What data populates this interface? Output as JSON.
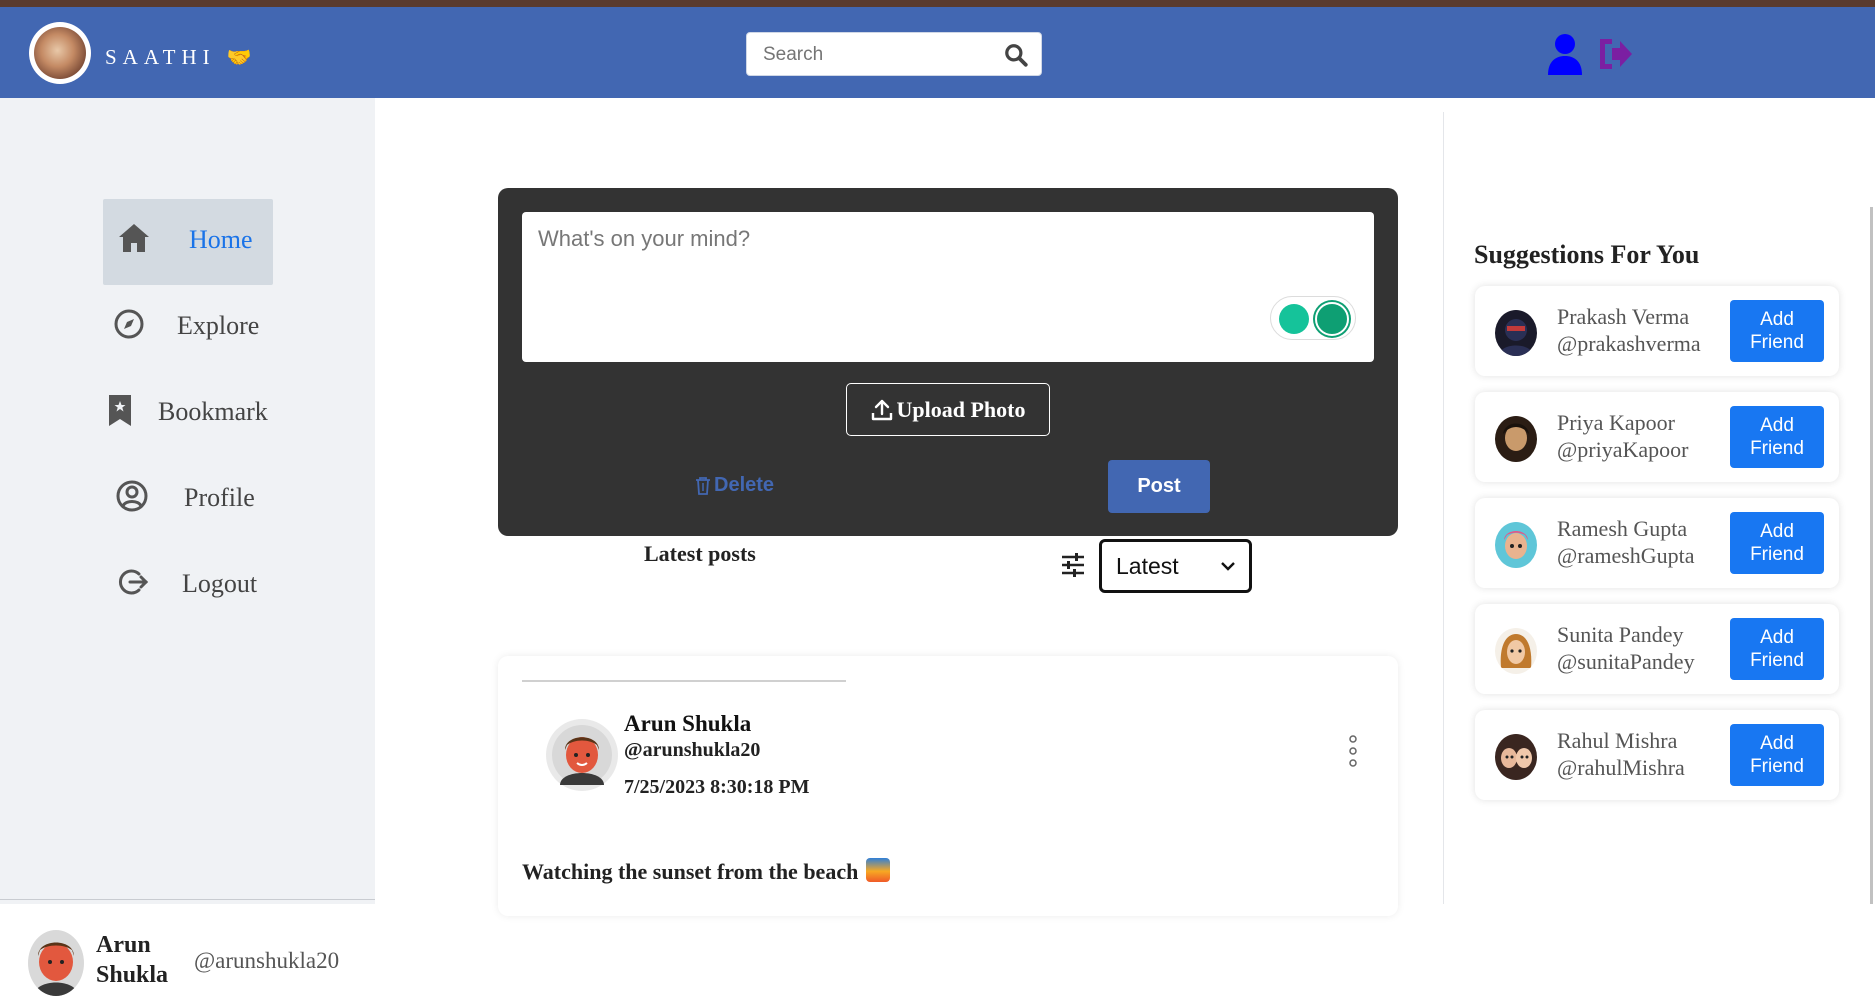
{
  "header": {
    "brand": "SAATHI",
    "brand_emoji": "🤝",
    "search_placeholder": "Search"
  },
  "sidebar": {
    "items": [
      {
        "label": "Home",
        "icon": "home-icon",
        "active": true
      },
      {
        "label": "Explore",
        "icon": "compass-icon",
        "active": false
      },
      {
        "label": "Bookmark",
        "icon": "bookmark-icon",
        "active": false
      },
      {
        "label": "Profile",
        "icon": "user-circle-icon",
        "active": false
      },
      {
        "label": "Logout",
        "icon": "logout-icon",
        "active": false
      }
    ],
    "user": {
      "name": "Arun Shukla",
      "handle": "@arunshukla20"
    }
  },
  "composer": {
    "placeholder": "What's on your mind?",
    "upload_label": "Upload Photo",
    "delete_label": "Delete",
    "post_label": "Post"
  },
  "feed": {
    "title": "Latest posts",
    "sort_value": "Latest",
    "posts": [
      {
        "name": "Arun Shukla",
        "handle": "@arunshukla20",
        "time": "7/25/2023 8:30:18 PM",
        "text": "Watching the sunset from the beach"
      }
    ]
  },
  "suggestions": {
    "title": "Suggestions For You",
    "add_label": "Add Friend",
    "items": [
      {
        "name": "Prakash Verma",
        "handle": "@prakashverma"
      },
      {
        "name": "Priya Kapoor",
        "handle": "@priyaKapoor"
      },
      {
        "name": "Ramesh Gupta",
        "handle": "@rameshGupta"
      },
      {
        "name": "Sunita Pandey",
        "handle": "@sunitaPandey"
      },
      {
        "name": "Rahul Mishra",
        "handle": "@rahulMishra"
      }
    ]
  },
  "colors": {
    "header": "#4267b2",
    "accent_blue": "#1877f2",
    "user_icon": "#0000ff",
    "logout_icon": "#7b1fa2"
  }
}
